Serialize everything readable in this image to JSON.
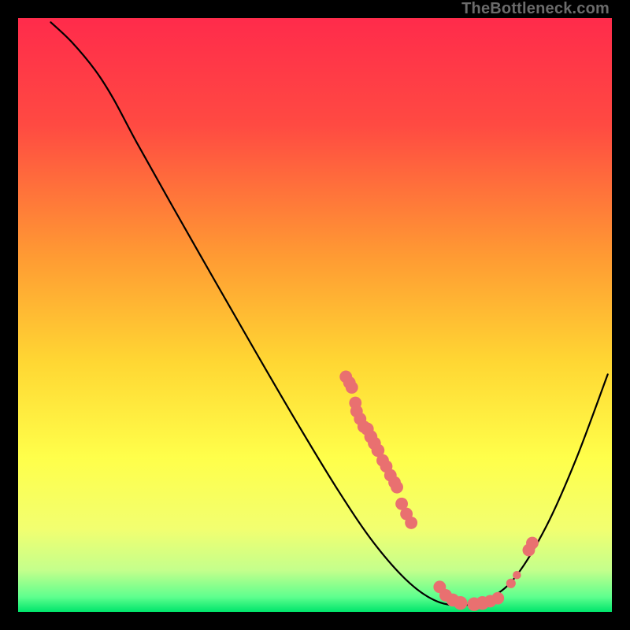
{
  "watermark": "TheBottleneck.com",
  "chart_data": {
    "type": "line",
    "title": "",
    "xlabel": "",
    "ylabel": "",
    "xlim": [
      0,
      100
    ],
    "ylim": [
      0,
      100
    ],
    "gradient_stops": [
      {
        "offset": 0.0,
        "color": "#ff2b4b"
      },
      {
        "offset": 0.18,
        "color": "#ff4a42"
      },
      {
        "offset": 0.4,
        "color": "#ff9a33"
      },
      {
        "offset": 0.58,
        "color": "#ffd733"
      },
      {
        "offset": 0.74,
        "color": "#ffff4a"
      },
      {
        "offset": 0.86,
        "color": "#f2ff70"
      },
      {
        "offset": 0.93,
        "color": "#c4ff8c"
      },
      {
        "offset": 0.975,
        "color": "#5eff8e"
      },
      {
        "offset": 1.0,
        "color": "#00e56b"
      }
    ],
    "curve": [
      {
        "x": 5.5,
        "y": 99.3
      },
      {
        "x": 9.0,
        "y": 96.0
      },
      {
        "x": 13.0,
        "y": 91.2
      },
      {
        "x": 16.0,
        "y": 86.5
      },
      {
        "x": 20.0,
        "y": 79.0
      },
      {
        "x": 26.0,
        "y": 68.3
      },
      {
        "x": 33.0,
        "y": 56.0
      },
      {
        "x": 40.0,
        "y": 43.8
      },
      {
        "x": 47.0,
        "y": 31.8
      },
      {
        "x": 54.0,
        "y": 20.3
      },
      {
        "x": 60.0,
        "y": 11.5
      },
      {
        "x": 66.0,
        "y": 4.8
      },
      {
        "x": 71.0,
        "y": 1.6
      },
      {
        "x": 76.0,
        "y": 1.2
      },
      {
        "x": 80.0,
        "y": 2.6
      },
      {
        "x": 84.0,
        "y": 6.2
      },
      {
        "x": 89.0,
        "y": 14.5
      },
      {
        "x": 94.0,
        "y": 25.8
      },
      {
        "x": 99.3,
        "y": 40.0
      }
    ],
    "markers": [
      {
        "x": 55.2,
        "y": 39.6,
        "r": 1.05
      },
      {
        "x": 55.8,
        "y": 38.6,
        "r": 1.05
      },
      {
        "x": 56.2,
        "y": 37.8,
        "r": 1.05
      },
      {
        "x": 56.8,
        "y": 35.2,
        "r": 1.05
      },
      {
        "x": 57.0,
        "y": 33.8,
        "r": 1.05
      },
      {
        "x": 57.6,
        "y": 32.5,
        "r": 1.05
      },
      {
        "x": 58.2,
        "y": 31.2,
        "r": 1.05
      },
      {
        "x": 58.8,
        "y": 30.8,
        "r": 1.1
      },
      {
        "x": 59.4,
        "y": 29.5,
        "r": 1.1
      },
      {
        "x": 60.0,
        "y": 28.4,
        "r": 1.1
      },
      {
        "x": 60.6,
        "y": 27.2,
        "r": 1.1
      },
      {
        "x": 61.4,
        "y": 25.5,
        "r": 1.05
      },
      {
        "x": 62.0,
        "y": 24.5,
        "r": 1.05
      },
      {
        "x": 62.7,
        "y": 23.0,
        "r": 1.05
      },
      {
        "x": 63.4,
        "y": 21.8,
        "r": 1.05
      },
      {
        "x": 63.8,
        "y": 21.0,
        "r": 1.05
      },
      {
        "x": 64.6,
        "y": 18.2,
        "r": 1.05
      },
      {
        "x": 65.4,
        "y": 16.5,
        "r": 1.05
      },
      {
        "x": 66.2,
        "y": 15.0,
        "r": 1.05
      },
      {
        "x": 71.0,
        "y": 4.2,
        "r": 1.05
      },
      {
        "x": 72.0,
        "y": 2.8,
        "r": 1.05
      },
      {
        "x": 73.2,
        "y": 2.0,
        "r": 1.1
      },
      {
        "x": 74.5,
        "y": 1.5,
        "r": 1.15
      },
      {
        "x": 76.8,
        "y": 1.3,
        "r": 1.15
      },
      {
        "x": 78.2,
        "y": 1.5,
        "r": 1.15
      },
      {
        "x": 79.5,
        "y": 1.8,
        "r": 1.05
      },
      {
        "x": 80.8,
        "y": 2.3,
        "r": 1.05
      },
      {
        "x": 83.0,
        "y": 4.8,
        "r": 0.8
      },
      {
        "x": 84.0,
        "y": 6.2,
        "r": 0.7
      },
      {
        "x": 86.0,
        "y": 10.4,
        "r": 1.05
      },
      {
        "x": 86.6,
        "y": 11.6,
        "r": 1.05
      }
    ],
    "marker_color": "#e97070"
  }
}
